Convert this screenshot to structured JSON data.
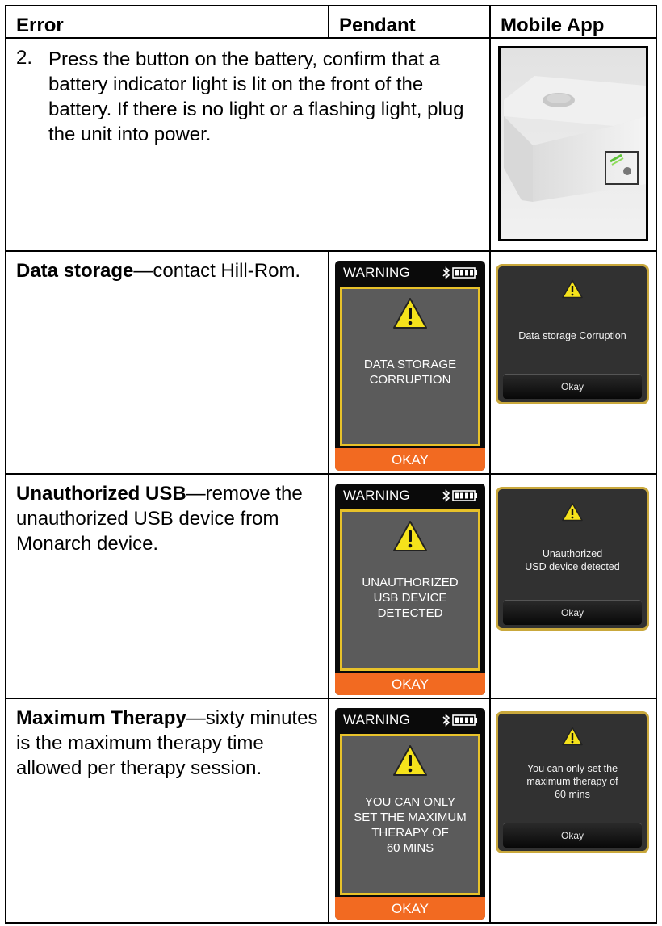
{
  "header": {
    "col_error": "Error",
    "col_pendant": "Pendant",
    "col_app": "Mobile App"
  },
  "step": {
    "number": "2.",
    "text": "Press the button on the battery, confirm that a battery indicator light is lit on the front of the battery. If there is no light or a flashing light, plug the unit into power."
  },
  "rows": [
    {
      "error_title": "Data storage",
      "error_desc": "—contact Hill-Rom.",
      "pendant": {
        "header": "WARNING",
        "message": "DATA STORAGE\nCORRUPTION",
        "button": "OKAY"
      },
      "app": {
        "message": "Data storage Corruption",
        "button": "Okay"
      }
    },
    {
      "error_title": "Unauthorized USB",
      "error_desc": "—remove the unauthorized USB device from Monarch device.",
      "pendant": {
        "header": "WARNING",
        "message": "UNAUTHORIZED\nUSB DEVICE\nDETECTED",
        "button": "OKAY"
      },
      "app": {
        "message": "Unauthorized\nUSD device detected",
        "button": "Okay"
      }
    },
    {
      "error_title": "Maximum Therapy",
      "error_desc": "—sixty minutes is the maximum therapy time allowed per therapy session.",
      "pendant": {
        "header": "WARNING",
        "message": "YOU CAN ONLY\nSET THE MAXIMUM\nTHERAPY OF\n60 MINS",
        "button": "OKAY"
      },
      "app": {
        "message": "You can only set the\nmaximum therapy of\n60 mins",
        "button": "Okay"
      }
    }
  ],
  "icons": {
    "warning": "warning-triangle-icon",
    "bluetooth": "bluetooth-icon",
    "battery": "battery-full-icon"
  },
  "colors": {
    "pendant_okay": "#f26a21",
    "pendant_border": "#e8c22a",
    "app_border": "#c9a83c",
    "warning_yellow": "#f5e21b",
    "battery_led": "#5bc236"
  }
}
